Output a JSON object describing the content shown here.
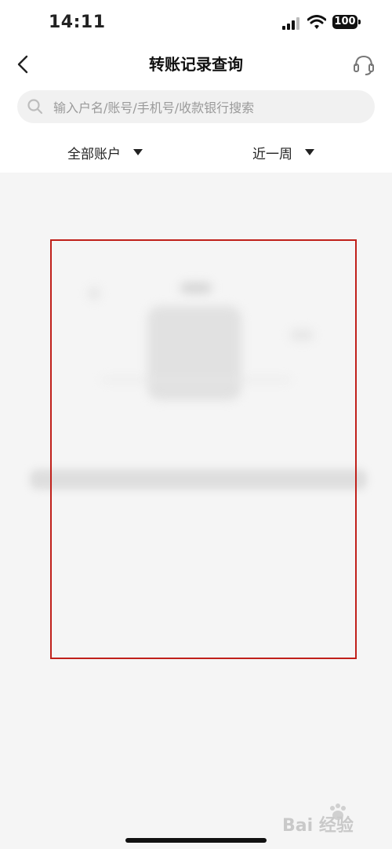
{
  "status_bar": {
    "time": "14:11",
    "battery": "100",
    "icons": [
      "signal-icon",
      "wifi-icon",
      "battery-icon"
    ]
  },
  "nav": {
    "title": "转账记录查询",
    "back_icon": "chevron-left-icon",
    "service_icon": "headset-icon"
  },
  "search": {
    "placeholder": "输入户名/账号/手机号/收款银行搜索",
    "icon": "search-icon"
  },
  "filters": {
    "account": "全部账户",
    "period": "近一周"
  },
  "watermark": {
    "text": "Bai 经验"
  },
  "colors": {
    "background": "#f5f5f5",
    "header": "#ffffff",
    "highlight_border": "#c0201a"
  }
}
